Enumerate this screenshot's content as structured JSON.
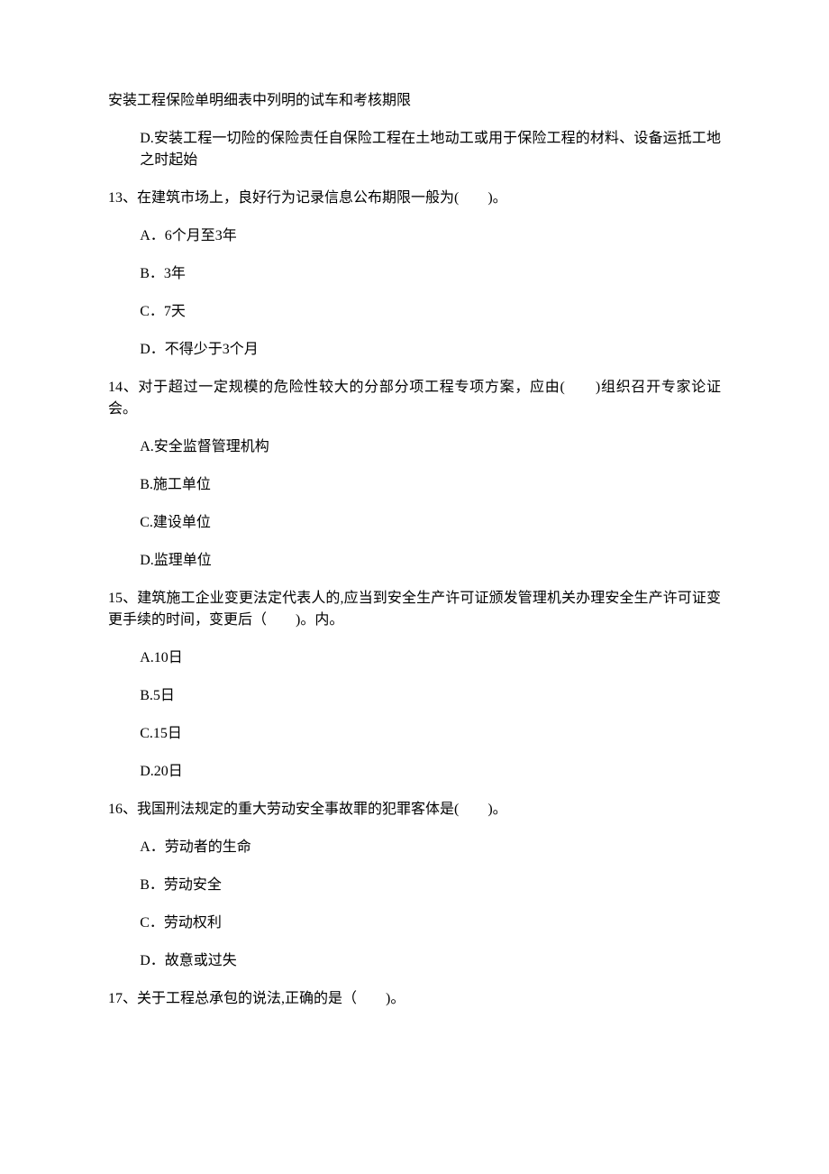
{
  "continuation": {
    "line1": "安装工程保险单明细表中列明的试车和考核期限",
    "optD": "D.安装工程一切险的保险责任自保险工程在土地动工或用于保险工程的材料、设备运抵工地之时起始"
  },
  "q13": {
    "stem": "13、在建筑市场上，良好行为记录信息公布期限一般为(　　)。",
    "A": "A．6个月至3年",
    "B": "B．3年",
    "C": "C．7天",
    "D": "D．不得少于3个月"
  },
  "q14": {
    "stem": "14、对于超过一定规模的危险性较大的分部分项工程专项方案，应由(　　)组织召开专家论证会。",
    "A": "A.安全监督管理机构",
    "B": "B.施工单位",
    "C": "C.建设单位",
    "D": "D.监理单位"
  },
  "q15": {
    "stem": "15、建筑施工企业变更法定代表人的,应当到安全生产许可证颁发管理机关办理安全生产许可证变更手续的时间，变更后（　　)。内。",
    "A": "A.10日",
    "B": "B.5日",
    "C": "C.15日",
    "D": "D.20日"
  },
  "q16": {
    "stem": "16、我国刑法规定的重大劳动安全事故罪的犯罪客体是(　　)。",
    "A": "A．劳动者的生命",
    "B": "B．劳动安全",
    "C": "C．劳动权利",
    "D": "D．故意或过失"
  },
  "q17": {
    "stem": "17、关于工程总承包的说法,正确的是（　　)。"
  }
}
